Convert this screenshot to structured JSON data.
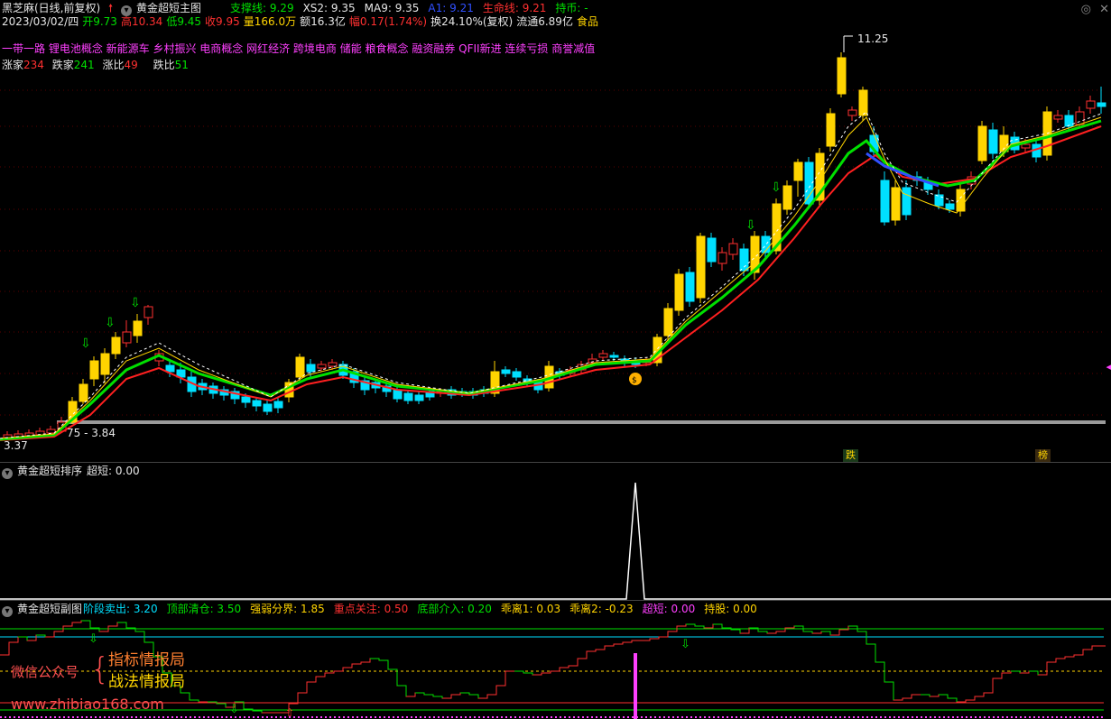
{
  "main": {
    "title_row": {
      "stock": "黑芝麻(日线,前复权)",
      "indicator_name": "黄金超短主图",
      "items": [
        {
          "label": "支撑线: 9.29",
          "color": "#00e000"
        },
        {
          "label": "XS2: 9.35",
          "color": "#e6e6e6"
        },
        {
          "label": "MA9: 9.35",
          "color": "#e6e6e6"
        },
        {
          "label": "A1: 9.21",
          "color": "#3050ff"
        },
        {
          "label": "生命线: 9.21",
          "color": "#ff3030"
        },
        {
          "label": "持币: -",
          "color": "#00e000"
        }
      ]
    },
    "quote_row": [
      {
        "label": "2023/03/02/四",
        "color": "#e6e6e6"
      },
      {
        "label": "开9.73",
        "color": "#00e000"
      },
      {
        "label": "高10.34",
        "color": "#ff3030"
      },
      {
        "label": "低9.45",
        "color": "#00e000"
      },
      {
        "label": "收9.95",
        "color": "#ff3030"
      },
      {
        "label": "量166.0万",
        "color": "#ffd400"
      },
      {
        "label": "额16.3亿",
        "color": "#e6e6e6"
      },
      {
        "label": "幅0.17(1.74%)",
        "color": "#ff3030"
      },
      {
        "label": "换24.10%(复权)",
        "color": "#e6e6e6"
      },
      {
        "label": "流通6.89亿",
        "color": "#e6e6e6"
      },
      {
        "label": "食品",
        "color": "#ffd400"
      }
    ],
    "concepts": "一带一路 锂电池概念 新能源车 乡村振兴 电商概念 网红经济 跨境电商 储能 粮食概念 融资融券 QFII新进 连续亏损 商誉减值",
    "breadth": {
      "up_label": "涨家",
      "up_value": "234",
      "down_label": "跌家",
      "down_value": "241",
      "ratio_up_label": "涨比",
      "ratio_up_value": "49",
      "ratio_down_label": "跌比",
      "ratio_down_value": "51"
    },
    "high_label": "11.25",
    "low_label": "3.37",
    "range_label": "75 - 3.84",
    "tag1": "跌",
    "tag2": "榜"
  },
  "pane2": {
    "title": "黄金超短排序",
    "value_label": "超短: 0.00"
  },
  "pane3": {
    "title": "黄金超短副图",
    "items": [
      {
        "label": "阶段卖出: 3.20",
        "color": "#00e0ff"
      },
      {
        "label": "顶部清仓: 3.50",
        "color": "#00e000"
      },
      {
        "label": "强弱分界: 1.85",
        "color": "#ffd400"
      },
      {
        "label": "重点关注: 0.50",
        "color": "#ff3030"
      },
      {
        "label": "底部介入: 0.20",
        "color": "#00e000"
      },
      {
        "label": "乖离1: 0.03",
        "color": "#ffd400"
      },
      {
        "label": "乖离2: -0.23",
        "color": "#ffd400"
      },
      {
        "label": "超短: 0.00",
        "color": "#ff40ff"
      },
      {
        "label": "持股: 0.00",
        "color": "#ffd400"
      }
    ]
  },
  "watermark": {
    "left": "微信公众号",
    "line1": "指标情报局",
    "line2": "战法情报局",
    "url": "www.zhibiao168.com"
  },
  "colors": {
    "up": "#ff3030",
    "down": "#00e0ff",
    "yellow": "#ffd400",
    "green": "#00e000",
    "red": "#ff2020",
    "magenta": "#ff40ff"
  }
}
